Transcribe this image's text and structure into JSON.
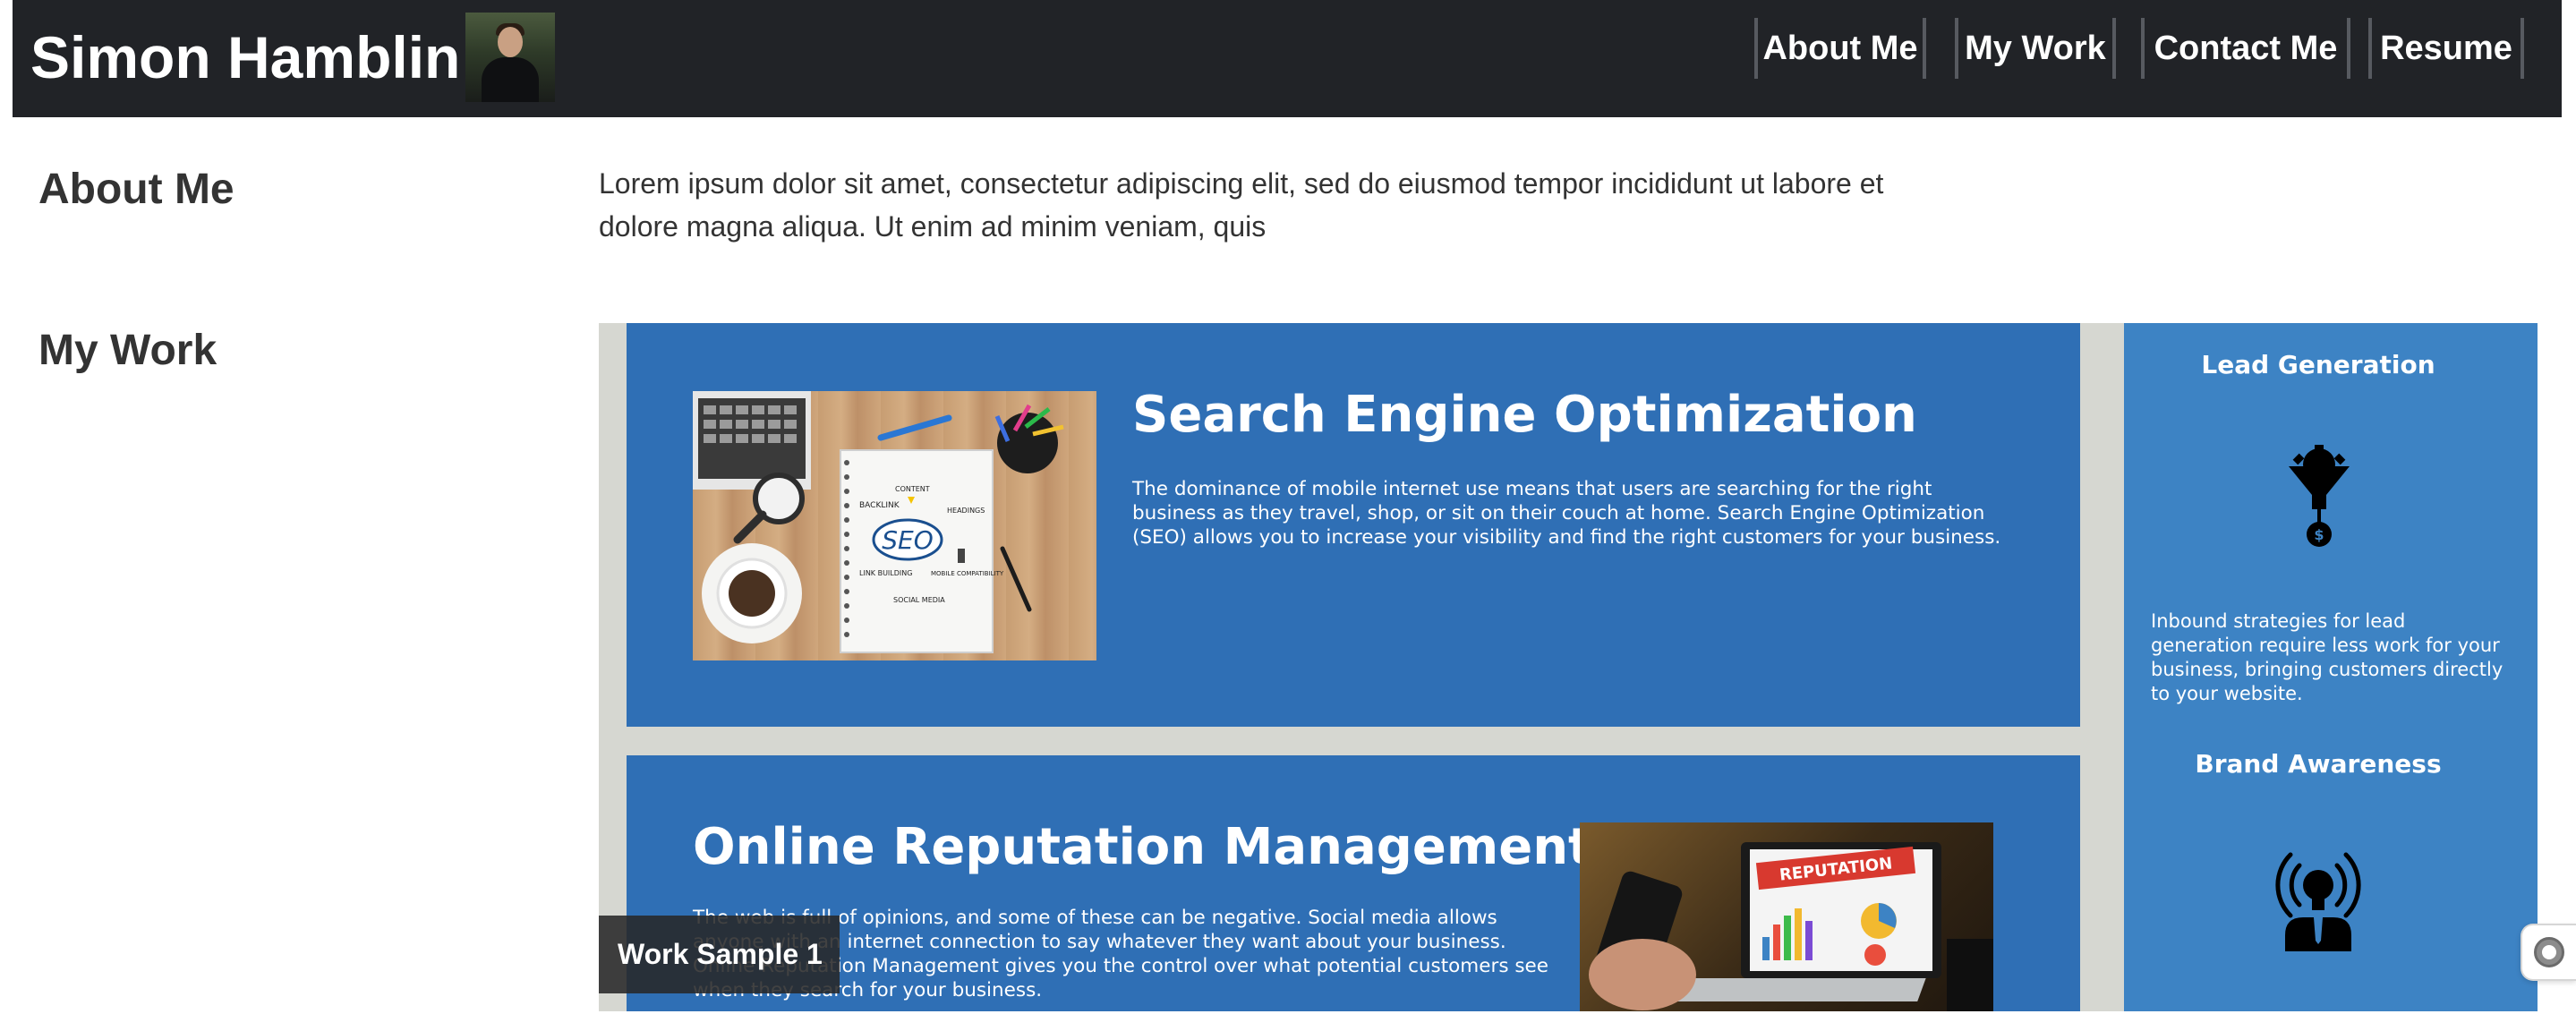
{
  "header": {
    "site_title": "Simon Hamblin",
    "nav": [
      {
        "label": "About Me"
      },
      {
        "label": "My Work"
      },
      {
        "label": "Contact Me"
      },
      {
        "label": "Resume"
      }
    ]
  },
  "about": {
    "heading": "About Me",
    "text": "Lorem ipsum dolor sit amet, consectetur adipiscing elit, sed do eiusmod tempor incididunt ut labore et dolore magna aliqua. Ut enim ad minim veniam, quis"
  },
  "work": {
    "heading": "My Work",
    "badge": "Work Sample 1",
    "seo": {
      "title": "Search Engine Optimization",
      "text": "The dominance of mobile internet use means that users are searching for the right business as they travel, shop, or sit on their couch at home. Search Engine Optimization (SEO) allows you to increase your visibility and find the right customers for your business.",
      "photo_labels": [
        "BACKLINK",
        "CONTENT",
        "HEADINGS",
        "SEO",
        "LINK BUILDING",
        "MOBILE COMPATIBILITY",
        "SOCIAL MEDIA"
      ]
    },
    "orm": {
      "title": "Online Reputation Management",
      "text": "The web is full of opinions, and some of these can be negative. Social media allows anyone with an internet connection to say whatever they want about your business. Online Reputation Management gives you the control over what potential customers see when they search for your business.",
      "photo_label": "REPUTATION"
    },
    "sidebar": {
      "lead_title": "Lead Generation",
      "lead_text": "Inbound strategies for lead generation require less work for your business, bringing customers directly to your website.",
      "brand_title": "Brand Awareness"
    }
  },
  "icons": {
    "avatar": "profile-photo",
    "lead": "funnel-gear-dollar-icon",
    "brand": "broadcast-person-icon",
    "float": "circle-button-icon"
  },
  "colors": {
    "header_bg": "#212327",
    "card_blue": "#2f6fb5",
    "sidebar_blue": "#3d83c4",
    "work_bg": "#d6d7d1"
  }
}
